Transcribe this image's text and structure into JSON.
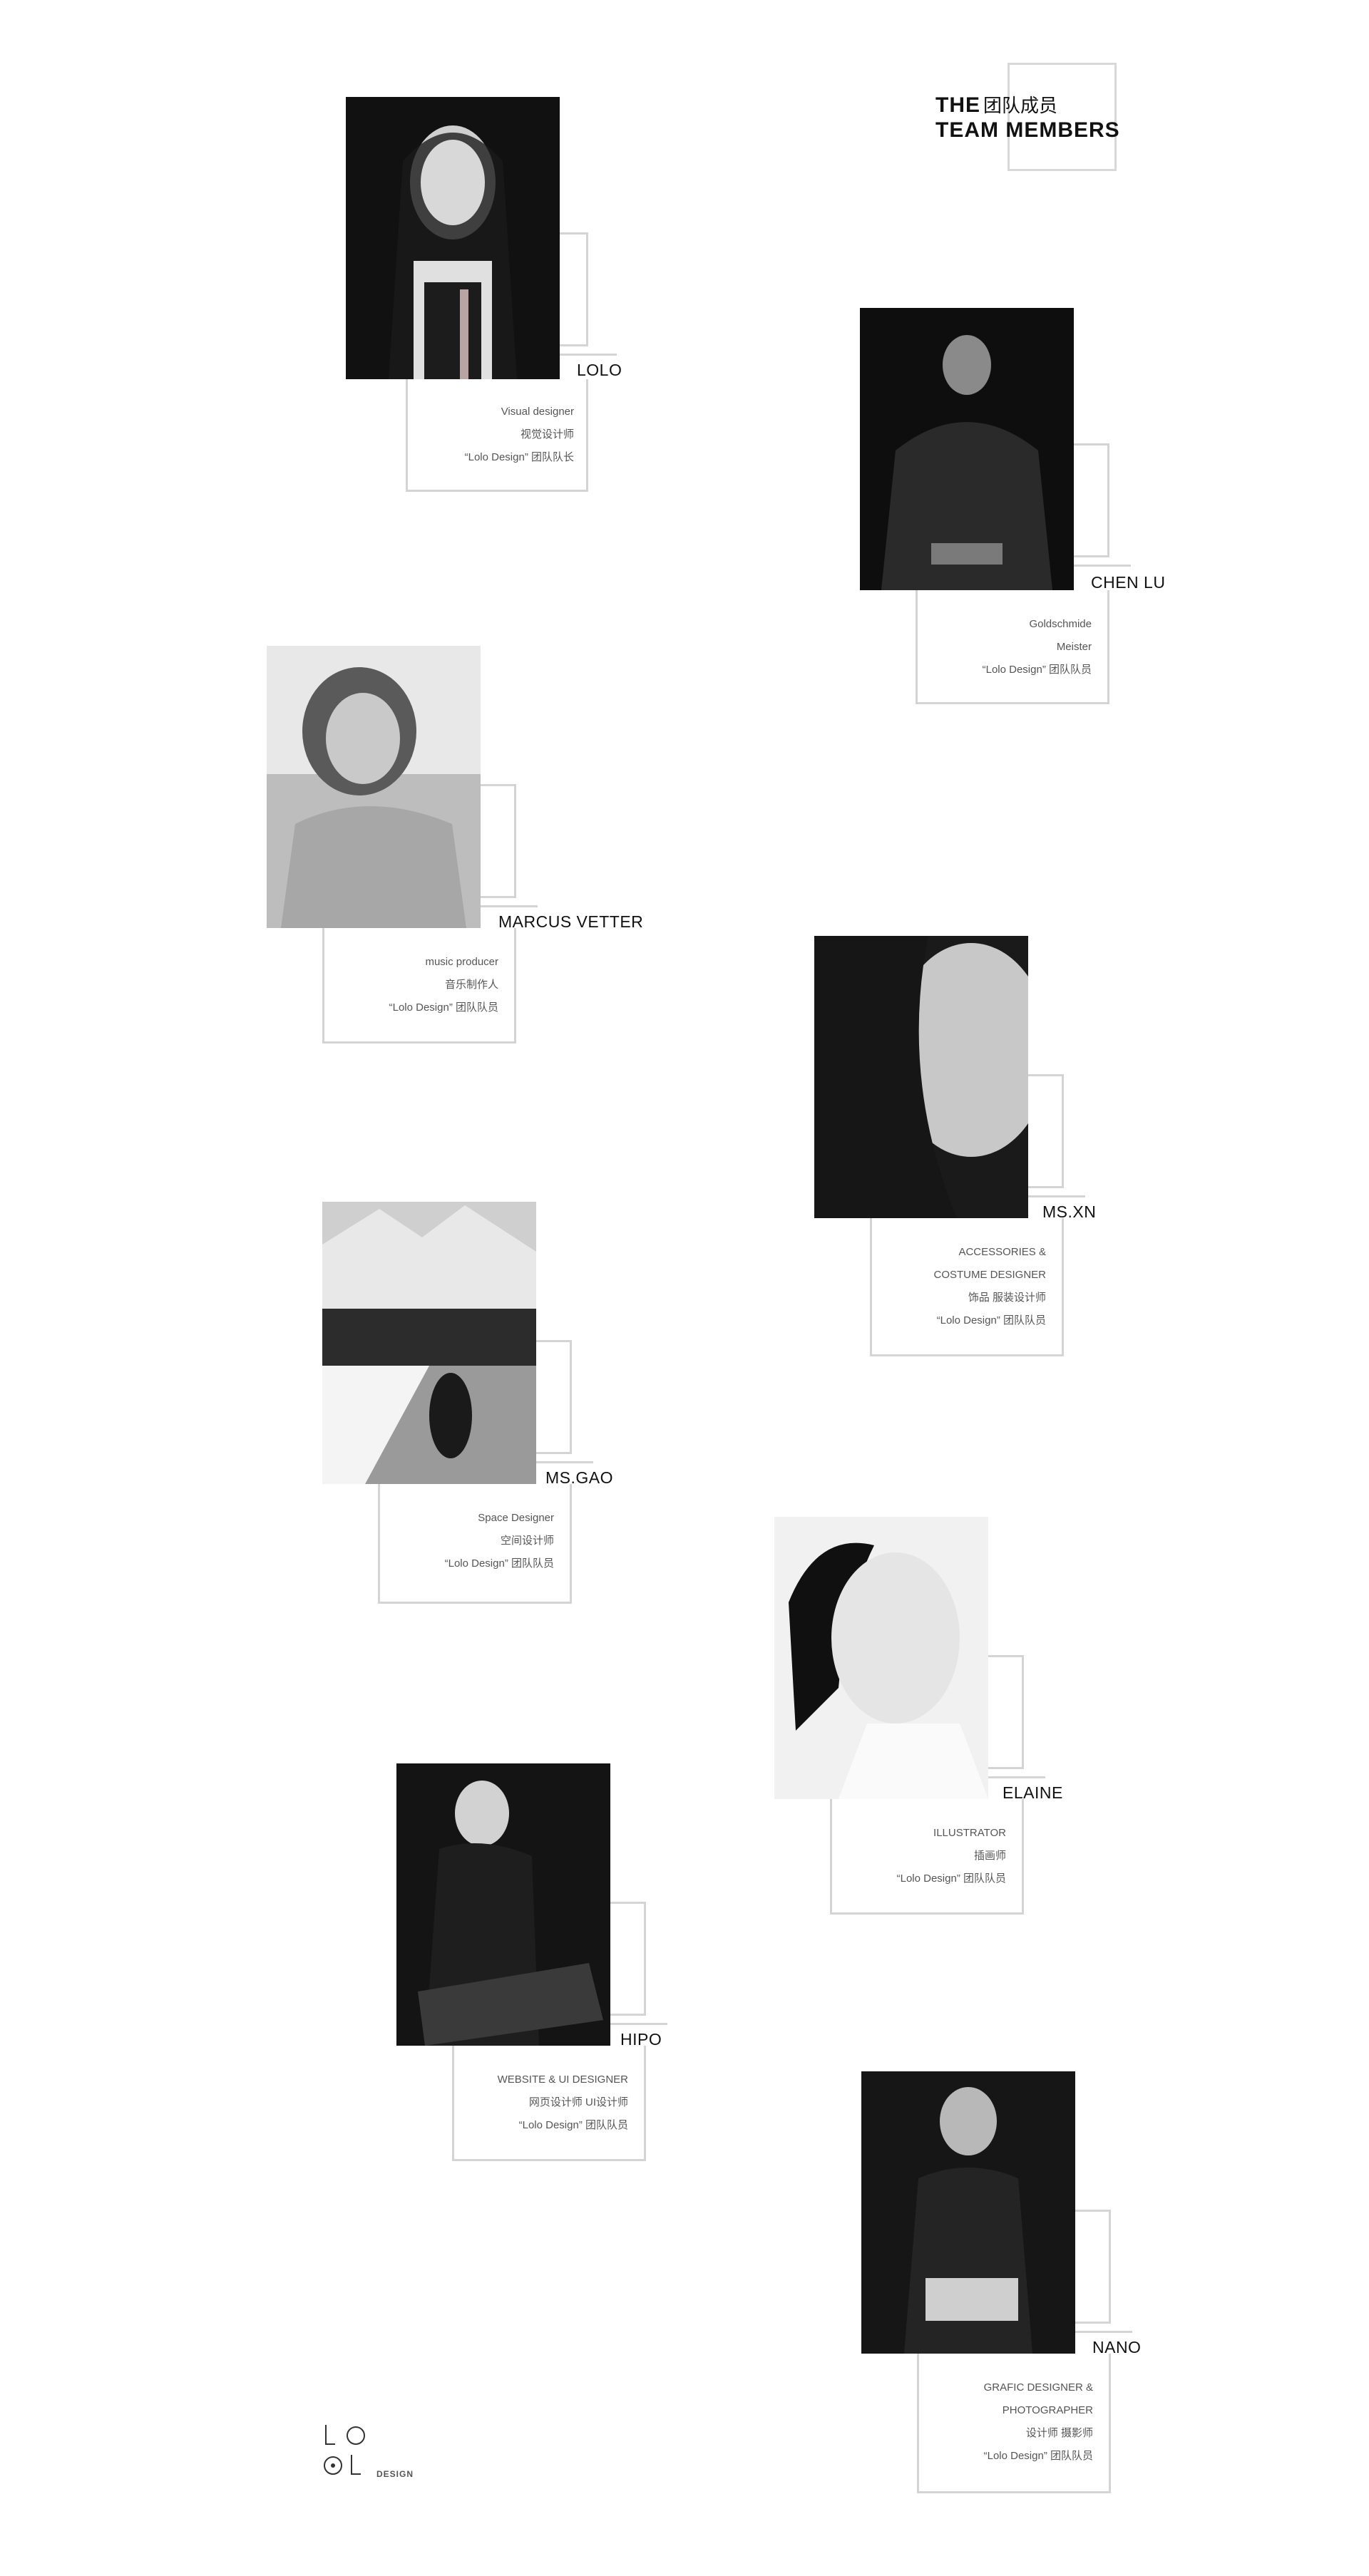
{
  "header": {
    "the": "THE",
    "cn": "团队成员",
    "team_members": "TEAM MEMBERS"
  },
  "members": [
    {
      "name": "LOLO",
      "lines": [
        "Visual designer",
        "视觉设计师",
        "“Lolo Design” 团队队长"
      ]
    },
    {
      "name": "CHEN LU",
      "lines": [
        "Goldschmide",
        "Meister",
        "“Lolo Design” 团队队员"
      ]
    },
    {
      "name": "MARCUS VETTER",
      "lines": [
        "music producer",
        "音乐制作人",
        "“Lolo Design” 团队队员"
      ]
    },
    {
      "name": "MS.XN",
      "lines": [
        "ACCESSORIES &",
        "COSTUME DESIGNER",
        "饰品  服装设计师",
        "“Lolo Design” 团队队员"
      ]
    },
    {
      "name": "MS.GAO",
      "lines": [
        "Space Designer",
        "空间设计师",
        "“Lolo Design” 团队队员"
      ]
    },
    {
      "name": "ELAINE",
      "lines": [
        "ILLUSTRATOR",
        "插画师",
        "“Lolo Design” 团队队员"
      ]
    },
    {
      "name": "HIPO",
      "lines": [
        "WEBSITE & UI DESIGNER",
        "网页设计师  UI设计师",
        "“Lolo Design” 团队队员"
      ]
    },
    {
      "name": "NANO",
      "lines": [
        "GRAFIC DESIGNER &",
        "PHOTOGRAPHER",
        "设计师  摄影师",
        "“Lolo Design” 团队队员"
      ]
    }
  ],
  "logo": {
    "text": "DESIGN"
  }
}
